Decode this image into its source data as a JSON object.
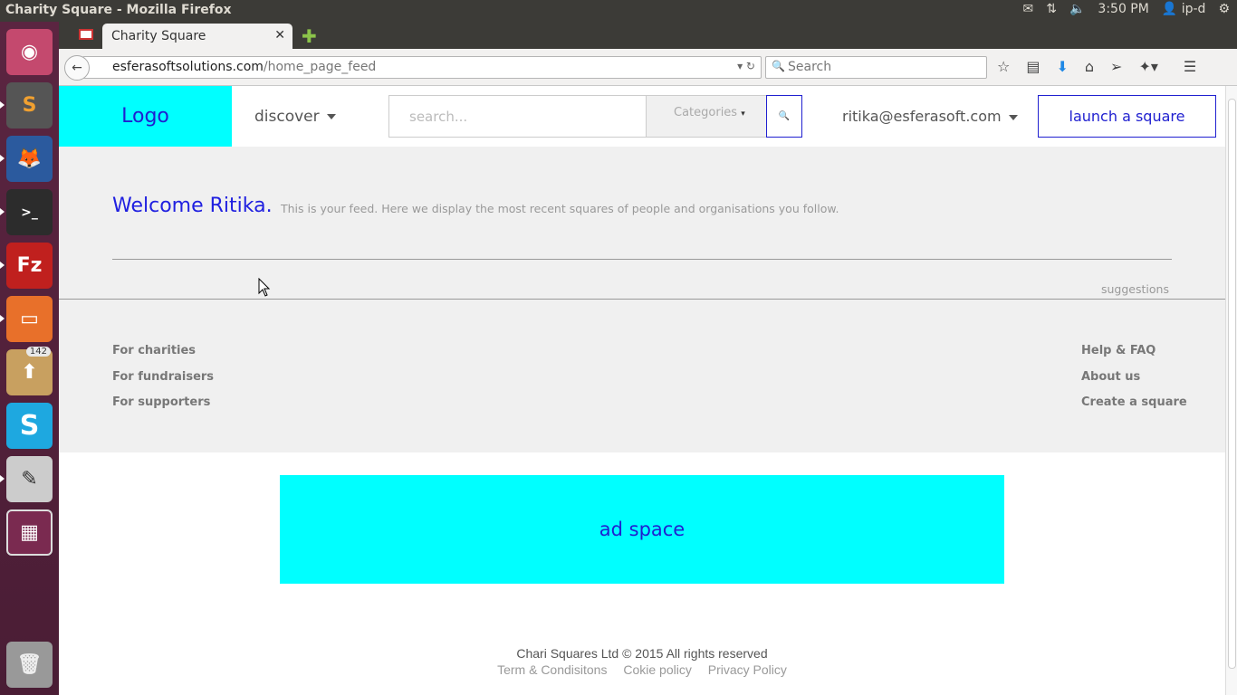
{
  "os": {
    "window_title": "Charity Square - Mozilla Firefox",
    "clock": "3:50 PM",
    "user": "ip-d",
    "launcher_badge": "142"
  },
  "browser": {
    "tab_title": "Charity Square",
    "url_host": "esferasoftsolutions.com",
    "url_path": "/home_page_feed",
    "search_placeholder": "Search"
  },
  "site": {
    "logo": "Logo",
    "discover": "discover",
    "search_placeholder": "search...",
    "categories": "Categories",
    "user_email": "ritika@esferasoft.com",
    "launch_button": "launch a square",
    "welcome": "Welcome Ritika.",
    "feed_description": "This is your feed. Here we display the most recent squares of people and organisations you follow.",
    "suggestions": "suggestions",
    "footer_left": [
      "For charities",
      "For fundraisers",
      "For supporters"
    ],
    "footer_right": [
      "Help & FAQ",
      "About us",
      "Create a square"
    ],
    "ad_space": "ad space",
    "copyright": "Chari Squares Ltd © 2015 All rights reserved",
    "legal_links": [
      "Term & Condisitons",
      "Cokie policy",
      "Privacy Policy"
    ]
  },
  "colors": {
    "accent_cyan": "#00ffff",
    "accent_blue": "#2020d0"
  }
}
